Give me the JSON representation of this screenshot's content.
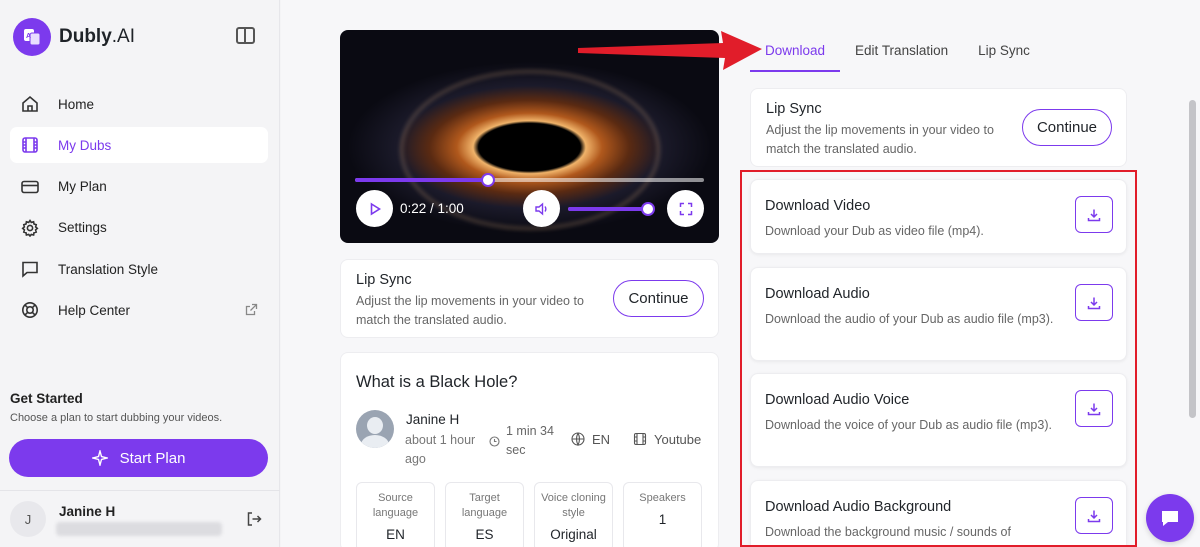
{
  "brand": {
    "name": "Dubly",
    "suffix": ".AI"
  },
  "sidebar": {
    "items": [
      {
        "label": "Home",
        "icon": "home-icon",
        "active": false
      },
      {
        "label": "My Dubs",
        "icon": "film-icon",
        "active": true
      },
      {
        "label": "My Plan",
        "icon": "credit-card-icon",
        "active": false
      },
      {
        "label": "Settings",
        "icon": "gear-icon",
        "active": false
      },
      {
        "label": "Translation Style",
        "icon": "chat-icon",
        "active": false
      },
      {
        "label": "Help Center",
        "icon": "lifebuoy-icon",
        "active": false,
        "external": true
      }
    ],
    "get_started": {
      "title": "Get Started",
      "subtitle": "Choose a plan to start dubbing your videos."
    },
    "start_plan_label": "Start Plan",
    "user": {
      "initial": "J",
      "name": "Janine H"
    }
  },
  "player": {
    "time": "0:22 / 1:00",
    "progress": 0.38,
    "volume": 0.95
  },
  "lip_sync_card": {
    "title": "Lip Sync",
    "description": "Adjust the lip movements in your video to match the translated audio.",
    "button": "Continue"
  },
  "video_info": {
    "title": "What is a Black Hole?",
    "author": "Janine H",
    "posted": "about 1 hour ago",
    "duration": "1 min 34 sec",
    "language": "EN",
    "source": "Youtube",
    "stats": [
      {
        "label": "Source language",
        "value": "EN"
      },
      {
        "label": "Target language",
        "value": "ES"
      },
      {
        "label": "Voice cloning style",
        "value": "Original"
      },
      {
        "label": "Speakers",
        "value": "1"
      }
    ]
  },
  "tabs": [
    {
      "label": "Download",
      "active": true
    },
    {
      "label": "Edit Translation",
      "active": false
    },
    {
      "label": "Lip Sync",
      "active": false
    }
  ],
  "downloads": [
    {
      "title": "Download Video",
      "description": "Download your Dub as video file (mp4)."
    },
    {
      "title": "Download Audio",
      "description": "Download the audio of your Dub as audio file (mp3)."
    },
    {
      "title": "Download Audio Voice",
      "description": "Download the voice of your Dub as audio file (mp3)."
    },
    {
      "title": "Download Audio Background",
      "description": "Download the background music / sounds of"
    }
  ],
  "colors": {
    "accent": "#7c3aed",
    "annotation": "#e11d2a"
  }
}
